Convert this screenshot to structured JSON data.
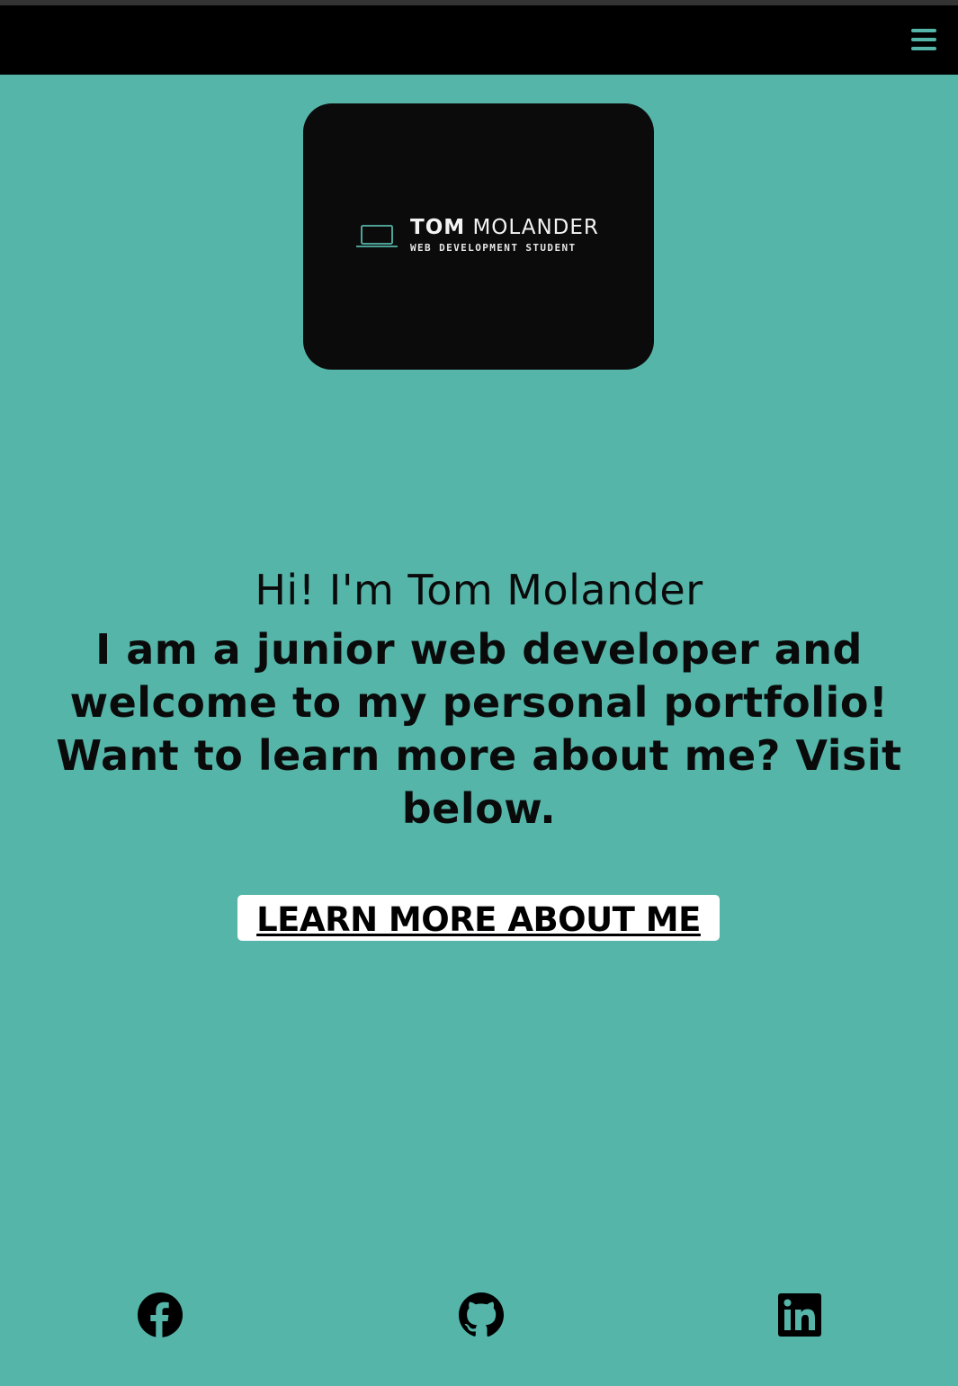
{
  "navbar": {
    "menu_icon": "hamburger-menu-icon",
    "accent_color": "#55b5a9"
  },
  "logo": {
    "name_bold": "TOM",
    "name_light": "MOLANDER",
    "subtitle": "WEB DEVELOPMENT STUDENT",
    "icon": "laptop-icon"
  },
  "hero": {
    "title": "Hi! I'm Tom Molander",
    "text": "I am a junior web developer and welcome to my personal portfolio! Want to learn more about me? Visit below."
  },
  "cta": {
    "label": "LEARN MORE ABOUT ME"
  },
  "social": {
    "facebook_icon": "facebook-icon",
    "github_icon": "github-icon",
    "linkedin_icon": "linkedin-icon"
  },
  "colors": {
    "background": "#55b5a9",
    "navbar": "#000000",
    "card": "#0b0b0b",
    "button": "#ffffff"
  }
}
